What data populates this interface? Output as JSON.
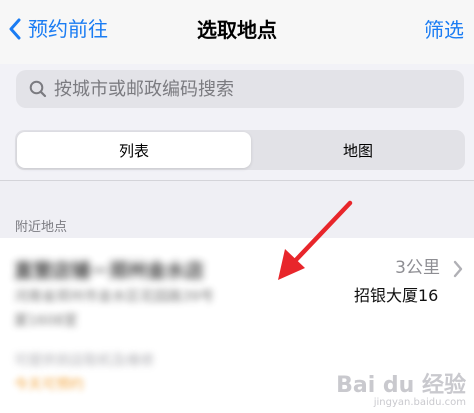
{
  "nav": {
    "back_label": "预约前往",
    "title": "选取地点",
    "filter_label": "筛选"
  },
  "search": {
    "placeholder": "按城市或邮政编码搜索"
  },
  "segments": {
    "list_label": "列表",
    "map_label": "地图",
    "selected": "列表"
  },
  "section": {
    "title": "附近地点"
  },
  "location": {
    "name": "直营店铺－郑州金水店",
    "detail_line1": "河南省郑州市金水区花园路39号",
    "detail_line2": "厦1608室",
    "distance": "3公里",
    "building": "招银大厦16",
    "hours": "可提供到店取机及维修",
    "tag": "今天可预约"
  },
  "watermark": {
    "main": "Bai du 经验",
    "sub": "jingyan.baidu.com"
  },
  "colors": {
    "accent": "#1a7cf3",
    "arrow": "#e8262b",
    "tag": "#f2a33a"
  }
}
